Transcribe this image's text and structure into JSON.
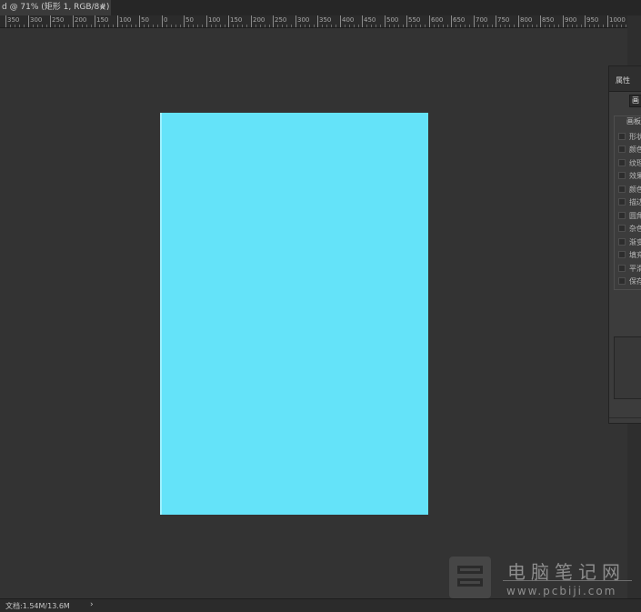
{
  "document_tab": {
    "title": "d @ 71% (矩形 1, RGB/8#) *",
    "close_glyph": "×"
  },
  "ruler": {
    "labels": [
      "350",
      "300",
      "250",
      "200",
      "150",
      "100",
      "50",
      "0",
      "50",
      "100",
      "150",
      "200",
      "250",
      "300",
      "350",
      "400",
      "450",
      "500",
      "550",
      "600",
      "650",
      "700",
      "750",
      "800",
      "850",
      "900",
      "950",
      "1000"
    ]
  },
  "canvas": {
    "artboard_color": "#64e3f9",
    "background_color": "#333333"
  },
  "properties_panel": {
    "title": "属性",
    "tab_button": "画",
    "group_label": "画板",
    "items": [
      "形状",
      "颜色",
      "纹理",
      "效果",
      "颜色",
      "描边",
      "圆角",
      "杂色",
      "渐变",
      "填充",
      "平滑",
      "保存"
    ]
  },
  "status_bar": {
    "doc_info": "文档:1.54M/13.6M",
    "arrow": "›"
  },
  "watermark": {
    "title": "电脑笔记网",
    "url": "www.pcbiji.com"
  }
}
